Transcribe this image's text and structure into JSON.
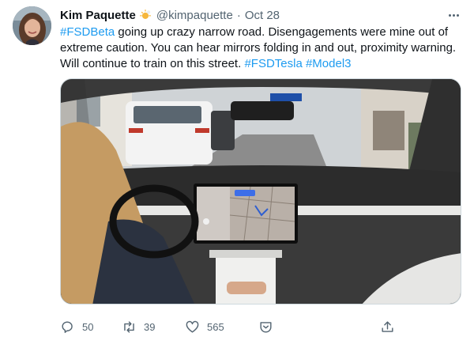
{
  "author": {
    "name": "Kim Paquette",
    "handle": "@kimpaquette",
    "separator": "·",
    "date": "Oct 28"
  },
  "tweet": {
    "segments": [
      {
        "text": "#FSDBeta",
        "type": "hashtag"
      },
      {
        "text": " going up crazy narrow road. Disengagements were mine out of extreme caution. You can hear mirrors folding in and out, proximity warning. Will continue to train on this street. ",
        "type": "text"
      },
      {
        "text": "#FSDTesla",
        "type": "hashtag"
      },
      {
        "text": " ",
        "type": "text"
      },
      {
        "text": "#Model3",
        "type": "hashtag"
      }
    ]
  },
  "media": {
    "kind": "video",
    "description_icon": "video-frame"
  },
  "actions": {
    "reply_count": "50",
    "retweet_count": "39",
    "like_count": "565"
  },
  "colors": {
    "accent": "#1d9bf0",
    "secondary_text": "#536471",
    "primary_text": "#0f1419"
  }
}
